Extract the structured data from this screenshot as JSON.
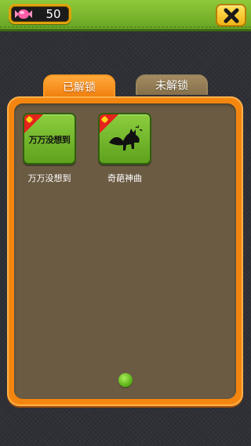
{
  "header": {
    "candy_count": "50",
    "candy_icon": "candy-icon",
    "close_icon": "close-icon"
  },
  "tabs": [
    {
      "label": "已解锁",
      "active": true
    },
    {
      "label": "未解锁",
      "active": false
    }
  ],
  "items": [
    {
      "name": "万万没想到",
      "tile_text": "万万没想到",
      "badge": "new-badge"
    },
    {
      "name": "奇葩神曲",
      "badge": "new-badge",
      "art": "fox-silhouette"
    }
  ],
  "pager": {
    "page": 1,
    "total": 1
  },
  "colors": {
    "topbar": "#7bb52e",
    "accent_orange": "#f4860f",
    "panel_inner": "#6b5b43",
    "tile_green": "#6fb42a",
    "close_yellow": "#f7c52a"
  }
}
